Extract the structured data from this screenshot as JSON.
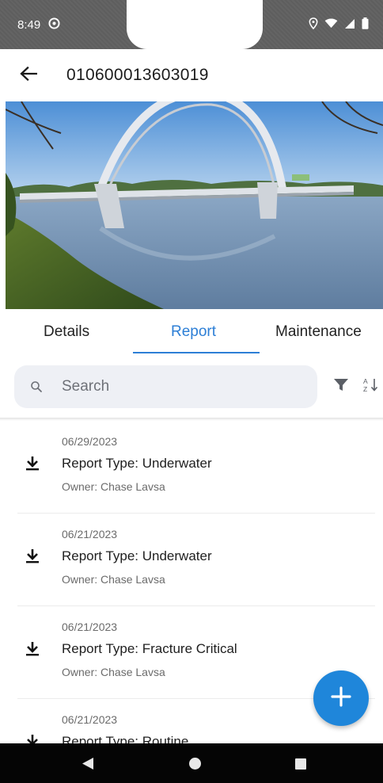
{
  "status_bar": {
    "time": "8:49"
  },
  "app_bar": {
    "title": "010600013603019"
  },
  "tabs": [
    {
      "label": "Details",
      "active": false
    },
    {
      "label": "Report",
      "active": true
    },
    {
      "label": "Maintenance",
      "active": false
    }
  ],
  "search": {
    "placeholder": "Search",
    "value": ""
  },
  "reports": [
    {
      "date": "06/29/2023",
      "type": "Report Type: Underwater",
      "owner": "Owner: Chase Lavsa"
    },
    {
      "date": "06/21/2023",
      "type": "Report Type: Underwater",
      "owner": "Owner: Chase Lavsa"
    },
    {
      "date": "06/21/2023",
      "type": "Report Type: Fracture Critical",
      "owner": "Owner: Chase Lavsa"
    },
    {
      "date": "06/21/2023",
      "type": "Report Type: Routine",
      "owner": ""
    }
  ],
  "icons": {
    "back": "arrow-left-icon",
    "search": "search-icon",
    "filter": "filter-icon",
    "sort": "sort-az-icon",
    "download": "download-icon",
    "fab": "plus-icon"
  },
  "colors": {
    "accent": "#2d7fd6",
    "fab": "#1f86da",
    "search_bg": "#eef0f5",
    "status_bar": "#5e5e5e",
    "nav_bar": "#050505"
  }
}
